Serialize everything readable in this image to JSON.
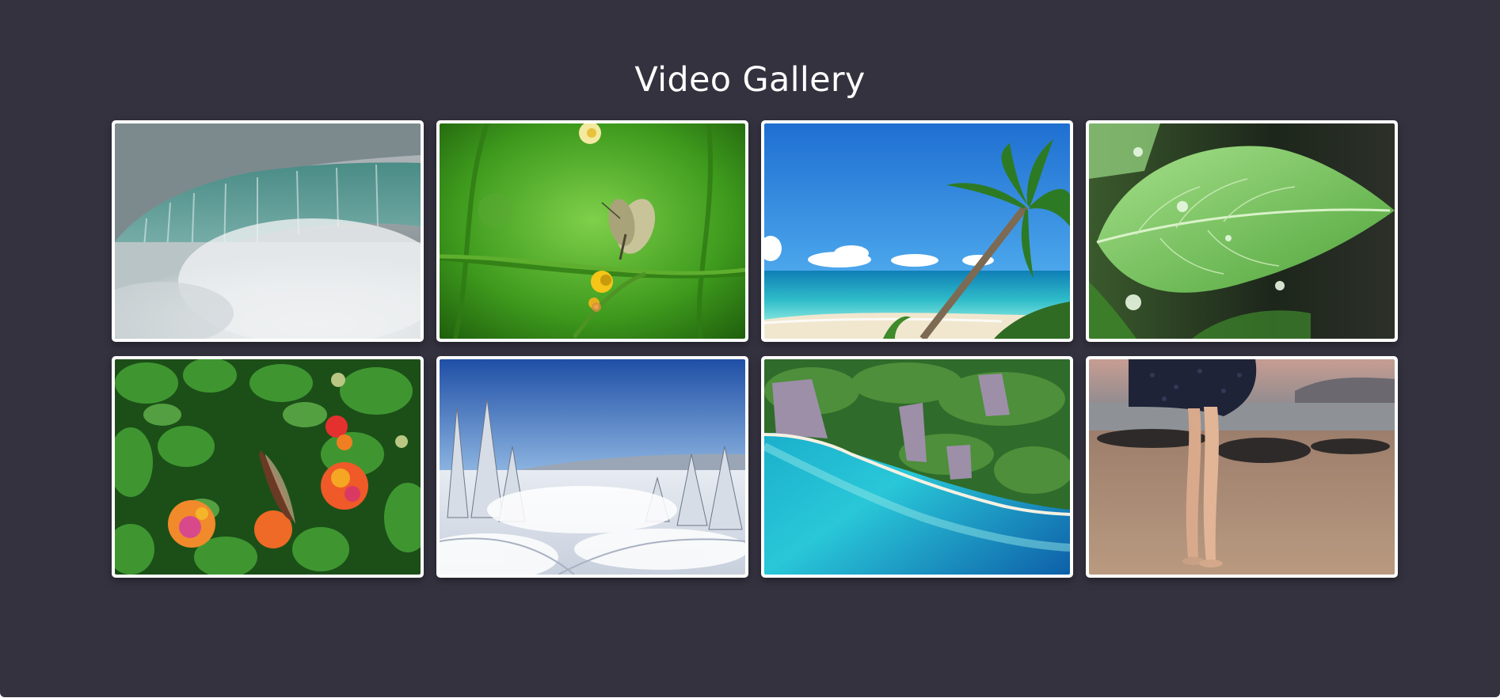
{
  "header": {
    "title": "Video Gallery"
  },
  "colors": {
    "background": "#34323f",
    "tile_border": "#ffffff",
    "title_text": "#ffffff"
  },
  "gallery": {
    "videos": [
      {
        "thumbnail": "waterfall"
      },
      {
        "thumbnail": "butterfly-on-yellow-flower"
      },
      {
        "thumbnail": "tropical-beach-palm"
      },
      {
        "thumbnail": "green-leaf-water-drops"
      },
      {
        "thumbnail": "butterfly-on-lantana-flowers"
      },
      {
        "thumbnail": "snowy-forest"
      },
      {
        "thumbnail": "aerial-tropical-coast"
      },
      {
        "thumbnail": "barefoot-on-beach"
      }
    ]
  }
}
